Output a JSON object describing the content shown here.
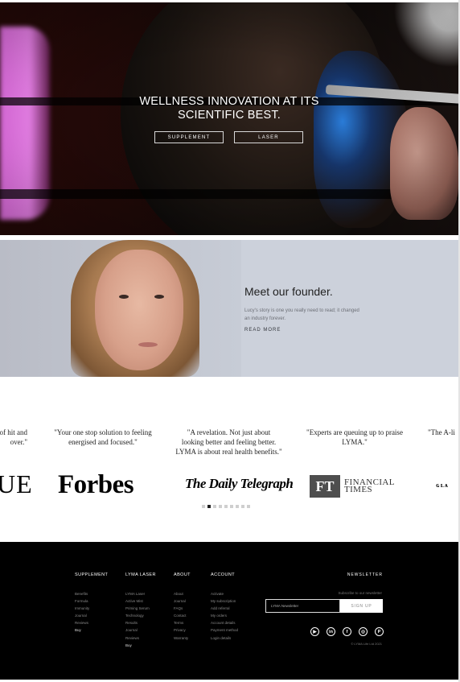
{
  "hero": {
    "title": "WELLNESS INNOVATION AT ITS SCIENTIFIC BEST.",
    "buttons": [
      "SUPPLEMENT",
      "LASER"
    ]
  },
  "founder": {
    "title": "Meet our founder.",
    "text": "Lucy's story is one you really need to read; it changed an industry forever.",
    "link": "READ MORE"
  },
  "press": {
    "quotes": [
      "days of hit and over.\"",
      "\"Your one stop solution to feeling energised and focused.\"",
      "\"A revelation. Not just about looking better and feeling better. LYMA is about real health benefits.\"",
      "\"Experts are queuing up to praise LYMA.\"",
      "\"The A-li"
    ],
    "logos": {
      "vogue": "UE",
      "forbes": "Forbes",
      "telegraph": "The Daily Telegraph",
      "ft_box": "FT",
      "ft_line1": "FINANCIAL",
      "ft_line2": "TIMES",
      "cut": "ɢʟᴀ"
    },
    "dots_total": 9,
    "dots_active": 1
  },
  "footer": {
    "columns": [
      {
        "heading": "SUPPLEMENT",
        "links": [
          "Benefits",
          "Formula",
          "Immunity",
          "Journal",
          "Reviews",
          "Buy"
        ]
      },
      {
        "heading": "LYMA LASER",
        "links": [
          "LYMA Laser",
          "Active Mist",
          "Priming Serum",
          "Technology",
          "Results",
          "Journal",
          "Reviews",
          "Buy"
        ]
      },
      {
        "heading": "ABOUT",
        "links": [
          "About",
          "Journal",
          "FAQs",
          "Contact",
          "Terms",
          "Privacy",
          "Warranty"
        ]
      },
      {
        "heading": "ACCOUNT",
        "links": [
          "Activate",
          "My subscription",
          "Add referral",
          "My orders",
          "Account details",
          "Payment method",
          "Login details"
        ]
      }
    ],
    "newsletter": {
      "title": "NEWSLETTER",
      "subtitle": "Subscribe to our newsletter",
      "placeholder": "LYMA Newsletter",
      "button": "SIGN UP"
    },
    "socials": [
      "youtube-icon",
      "linkedin-icon",
      "facebook-icon",
      "instagram-icon",
      "pinterest-icon"
    ],
    "copyright": "© LYMA Life Ltd 2021"
  }
}
